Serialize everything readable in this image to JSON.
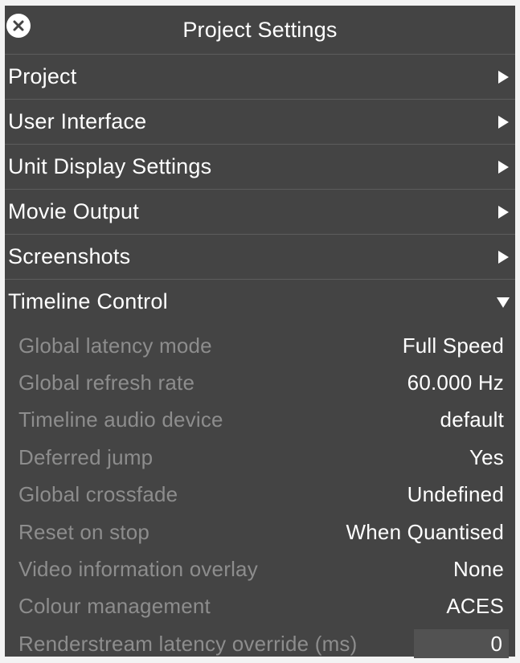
{
  "window": {
    "title": "Project Settings"
  },
  "sections": [
    {
      "label": "Project"
    },
    {
      "label": "User Interface"
    },
    {
      "label": "Unit Display Settings"
    },
    {
      "label": "Movie Output"
    },
    {
      "label": "Screenshots"
    },
    {
      "label": "Timeline Control"
    }
  ],
  "timeline_control": {
    "rows": [
      {
        "label": "Global latency mode",
        "value": "Full Speed"
      },
      {
        "label": "Global refresh rate",
        "value": "60.000 Hz"
      },
      {
        "label": "Timeline audio device",
        "value": "default"
      },
      {
        "label": "Deferred jump",
        "value": "Yes"
      },
      {
        "label": "Global crossfade",
        "value": "Undefined"
      },
      {
        "label": "Reset on stop",
        "value": "When Quantised"
      },
      {
        "label": "Video information overlay",
        "value": "None"
      },
      {
        "label": "Colour management",
        "value": "ACES"
      },
      {
        "label": "Renderstream latency override (ms)",
        "value": "0"
      }
    ]
  },
  "icons": {
    "close": "close-icon",
    "collapsed": "chevron-right-icon",
    "expanded": "chevron-down-icon"
  },
  "colors": {
    "panel_bg": "#444444",
    "label_muted": "#8d8d8d",
    "text": "#ffffff"
  }
}
